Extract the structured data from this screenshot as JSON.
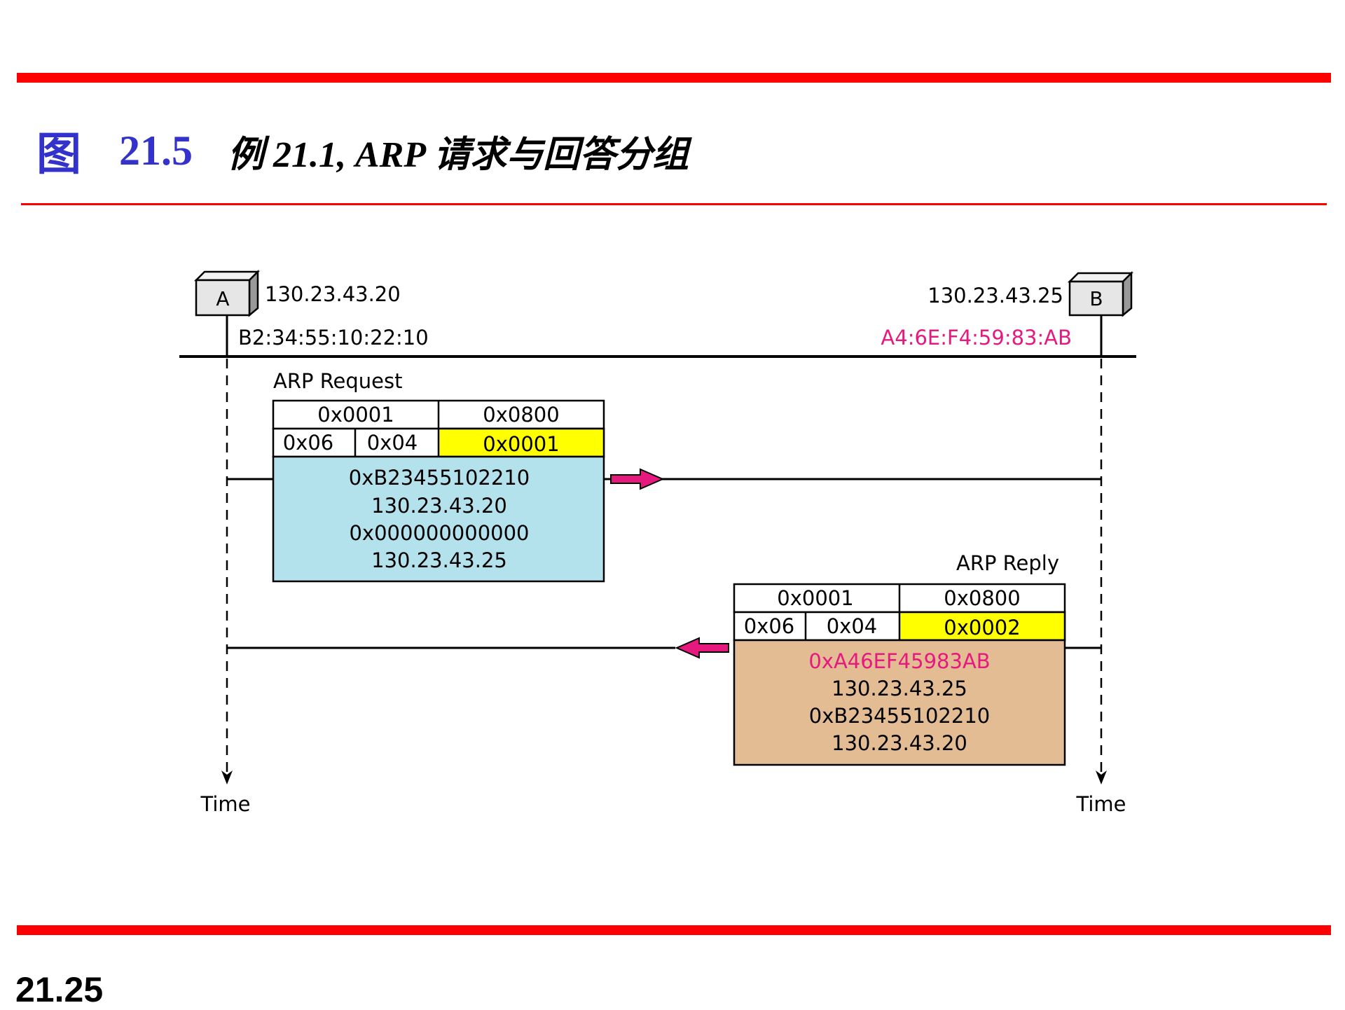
{
  "slide": {
    "title_prefix": "图",
    "figure_number": "21.5",
    "title_text": "例 21.1, ARP  请求与回答分组",
    "page_number": "21.25"
  },
  "hosts": {
    "a": {
      "label": "A",
      "ip": "130.23.43.20",
      "mac": "B2:34:55:10:22:10"
    },
    "b": {
      "label": "B",
      "ip": "130.23.43.25",
      "mac": "A4:6E:F4:59:83:AB"
    }
  },
  "request": {
    "caption": "ARP Request",
    "hardware_type": "0x0001",
    "protocol_type": "0x0800",
    "hardware_length": "0x06",
    "protocol_length": "0x04",
    "operation": "0x0001",
    "sender_hw": "0xB23455102210",
    "sender_ip": "130.23.43.20",
    "target_hw": "0x000000000000",
    "target_ip": "130.23.43.25"
  },
  "reply": {
    "caption": "ARP Reply",
    "hardware_type": "0x0001",
    "protocol_type": "0x0800",
    "hardware_length": "0x06",
    "protocol_length": "0x04",
    "operation": "0x0002",
    "sender_hw": "0xA46EF45983AB",
    "sender_ip": "130.23.43.25",
    "target_hw": "0xB23455102210",
    "target_ip": "130.23.43.20"
  },
  "time_label_a": "Time",
  "time_label_b": "Time",
  "colors": {
    "accent_red": "#ff0000",
    "title_blue": "#3333cc",
    "highlight_magenta": "#e6197f",
    "request_fill": "#b3e1ec",
    "reply_fill": "#e3bc94",
    "operation_fill": "#ffff00",
    "host_box_fill": "#e6e6e6"
  }
}
